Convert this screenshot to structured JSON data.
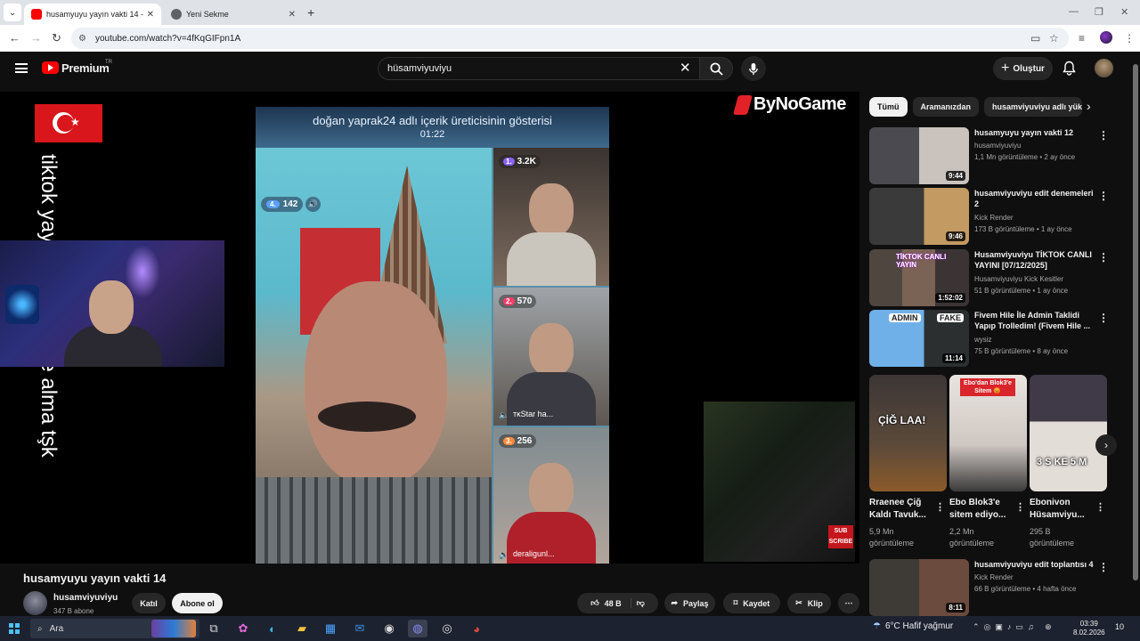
{
  "browser": {
    "tabs": [
      {
        "label": "husamyuyu yayın vakti 14 - YouTube",
        "active": true
      },
      {
        "label": "Yeni Sekme",
        "active": false
      }
    ],
    "url": "youtube.com/watch?v=4fKqGIFpn1A"
  },
  "header": {
    "brand": "Premium",
    "country": "TR",
    "search_query": "hüsamviyuviyu",
    "create_label": "Oluştur"
  },
  "video": {
    "vertical_text": "tiktok yayın atroulette'e alma tşk",
    "stream_title": "doğan yaprak24 adlı içerik üreticisinin gösterisi",
    "stream_timer": "01:22",
    "main_rank": "4.",
    "main_viewers": "142",
    "side": [
      {
        "rank": "1.",
        "count": "3.2K",
        "name": ""
      },
      {
        "rank": "2.",
        "count": "570",
        "name": "тκStar ha..."
      },
      {
        "rank": "3.",
        "count": "256",
        "name": "deraligunl..."
      }
    ],
    "sponsor": "ByNoGame",
    "subscribe_badge": "SUB SCRIBE"
  },
  "below": {
    "title": "husamyuyu yayın vakti 14",
    "channel": "husamviyuviyu",
    "subs": "347 B abone",
    "join": "Katıl",
    "subscribe": "Abone ol",
    "likes": "48 B",
    "share": "Paylaş",
    "save": "Kaydet",
    "clip": "Klip"
  },
  "sidebar": {
    "chips": [
      "Tümü",
      "Aramanızdan",
      "husamviyuviyu adlı yükleyicid"
    ],
    "recs": [
      {
        "title": "husamyuyu yayın vakti 12",
        "channel": "husamviyuviyu",
        "meta": "1,1 Mn görüntüleme • 2 ay önce",
        "duration": "9:44"
      },
      {
        "title": "husamviyuviyu edit denemeleri 2",
        "channel": "Kick Render",
        "meta": "173 B görüntüleme • 1 ay önce",
        "duration": "9:46"
      },
      {
        "title": "Husamviyuviyu TİKTOK CANLI YAYINI [07/12/2025]",
        "channel": "Husamviyuviyu Kick Kesitler",
        "meta": "51 B görüntüleme • 1 ay önce",
        "duration": "1:52:02"
      },
      {
        "title": "Fivem Hile İle Admin Taklidi Yapıp Trolledim! (Fivem Hile ...",
        "channel": "wysiz",
        "meta": "75 B görüntüleme • 8 ay önce",
        "duration": "11:14"
      },
      {
        "title": "husamviyuviyu edit toplantısı 4",
        "channel": "Kick Render",
        "meta": "66 B görüntüleme • 4 hafta önce",
        "duration": "8:11"
      }
    ],
    "shorts": [
      {
        "title": "Rraenee Çiğ Kaldı Tavuk...",
        "meta": "5,9 Mn görüntüleme",
        "caption": "ÇİĞ LAA!"
      },
      {
        "title": "Ebo Blok3'e sitem ediyo...",
        "meta": "2,2 Mn görüntüleme",
        "caption": "Ebo'dan Blok3'e Sitem 😡"
      },
      {
        "title": "Ebonivon Hüsamviyu...",
        "meta": "295 B görüntüleme",
        "caption": "3 S KE 5 M"
      }
    ],
    "thumb_labels": {
      "rec2": "TİKTOK CANLI YAYIN",
      "rec3_a": "ADMIN",
      "rec3_b": "FAKE"
    }
  },
  "taskbar": {
    "search": "Ara",
    "weather": "6°C  Hafif yağmur",
    "time": "03:39",
    "date": "8.02.2026",
    "notif_count": "10"
  }
}
